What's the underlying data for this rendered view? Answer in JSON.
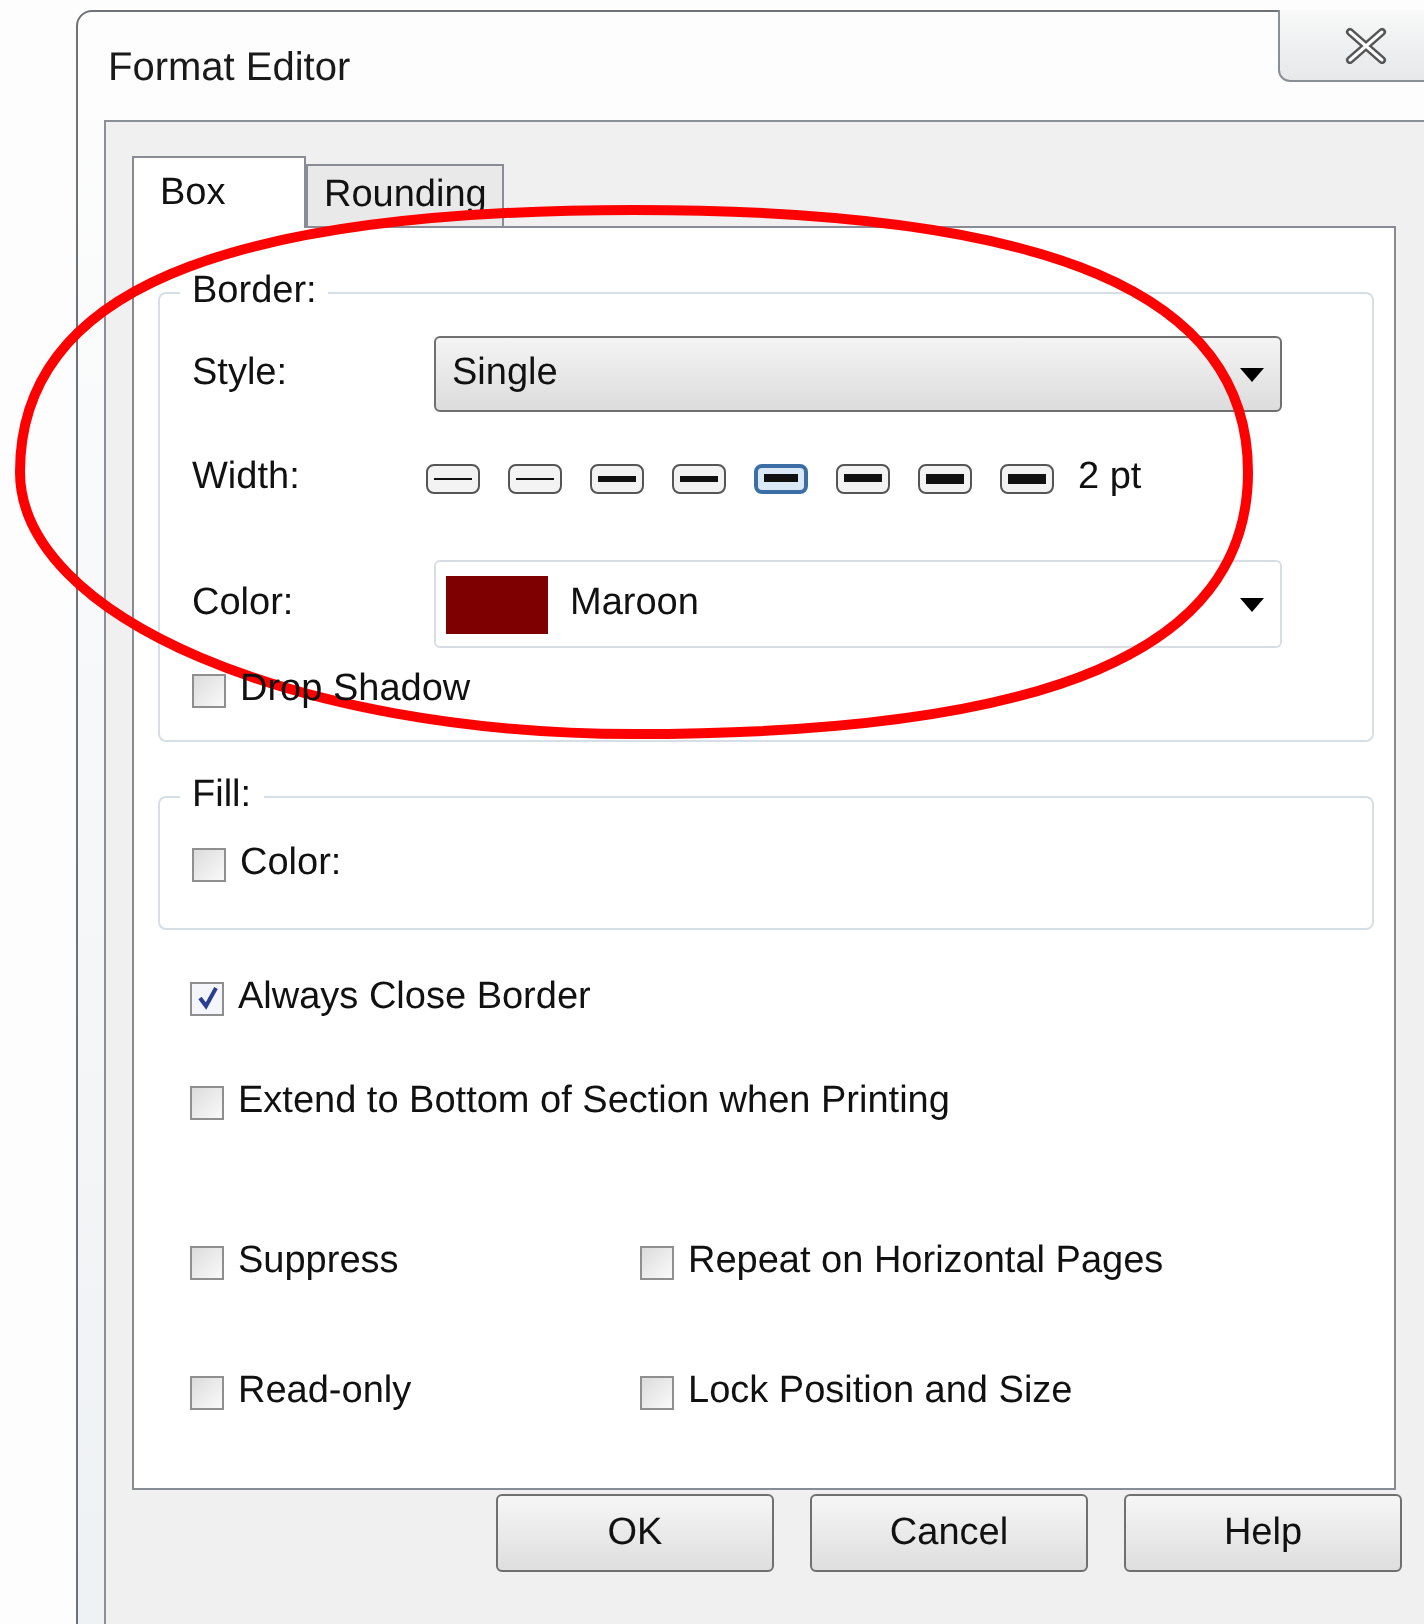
{
  "window": {
    "title": "Format Editor"
  },
  "tabs": [
    {
      "label": "Box",
      "selected": true
    },
    {
      "label": "Rounding",
      "selected": false
    }
  ],
  "border": {
    "legend": "Border:",
    "style": {
      "label": "Style:",
      "value": "Single"
    },
    "width": {
      "label": "Width:",
      "options": [
        {
          "selected": false
        },
        {
          "selected": false
        },
        {
          "selected": false
        },
        {
          "selected": false
        },
        {
          "selected": true
        },
        {
          "selected": false
        },
        {
          "selected": false
        },
        {
          "selected": false
        }
      ],
      "reading": "2 pt"
    },
    "color": {
      "label": "Color:",
      "color": "#7f0000",
      "value": "Maroon"
    },
    "drop_shadow": {
      "label": "Drop Shadow",
      "checked": false
    }
  },
  "fill": {
    "legend": "Fill:",
    "color": {
      "label": "Color:",
      "checked": false
    }
  },
  "options": [
    {
      "label": "Always Close Border",
      "checked": true
    },
    {
      "label": "Extend to Bottom of Section when Printing",
      "checked": false
    }
  ],
  "grid_options": [
    {
      "label": "Suppress",
      "checked": false
    },
    {
      "label": "Repeat on Horizontal Pages",
      "checked": false
    },
    {
      "label": "Read-only",
      "checked": false
    },
    {
      "label": "Lock Position and Size",
      "checked": false
    }
  ],
  "buttons": [
    "OK",
    "Cancel",
    "Help"
  ],
  "annotations": [
    {
      "kind": "ellipse"
    }
  ]
}
